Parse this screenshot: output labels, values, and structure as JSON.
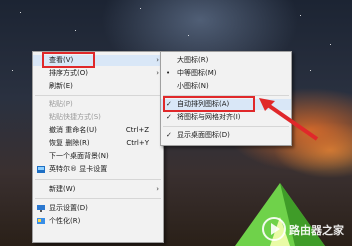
{
  "main_menu": [
    {
      "label": "查看(V)",
      "shortcut": "",
      "submenu": true,
      "disabled": false
    },
    {
      "label": "排序方式(O)",
      "shortcut": "",
      "submenu": true,
      "disabled": false
    },
    {
      "label": "刷新(E)",
      "shortcut": "",
      "submenu": false,
      "disabled": false
    },
    {
      "label": "粘贴(P)",
      "shortcut": "",
      "submenu": false,
      "disabled": true
    },
    {
      "label": "粘贴快捷方式(S)",
      "shortcut": "",
      "submenu": false,
      "disabled": true
    },
    {
      "label": "撤消 重命名(U)",
      "shortcut": "Ctrl+Z",
      "submenu": false,
      "disabled": false
    },
    {
      "label": "恢复 删除(R)",
      "shortcut": "Ctrl+Y",
      "submenu": false,
      "disabled": false
    },
    {
      "label": "下一个桌面背景(N)",
      "shortcut": "",
      "submenu": false,
      "disabled": false
    },
    {
      "label": "英特尔® 显卡设置",
      "shortcut": "",
      "submenu": false,
      "disabled": false,
      "icon": "intel-graphics-icon"
    },
    {
      "label": "新建(W)",
      "shortcut": "",
      "submenu": true,
      "disabled": false
    },
    {
      "label": "显示设置(D)",
      "shortcut": "",
      "submenu": false,
      "disabled": false,
      "icon": "display-settings-icon"
    },
    {
      "label": "个性化(R)",
      "shortcut": "",
      "submenu": false,
      "disabled": false,
      "icon": "personalize-icon"
    }
  ],
  "view_submenu": [
    {
      "label": "大图标(R)",
      "mark": ""
    },
    {
      "label": "中等图标(M)",
      "mark": "•"
    },
    {
      "label": "小图标(N)",
      "mark": ""
    },
    {
      "label": "自动排列图标(A)",
      "mark": "✓"
    },
    {
      "label": "将图标与网格对齐(I)",
      "mark": "✓"
    },
    {
      "label": "显示桌面图标(D)",
      "mark": "✓"
    }
  ],
  "colors": {
    "highlight_box": "#e0282a",
    "arrow": "#e0282a",
    "menu_bg": "#f2f2f2"
  },
  "watermark": {
    "text": "路由器之家",
    "icon": "play-logo-icon"
  }
}
